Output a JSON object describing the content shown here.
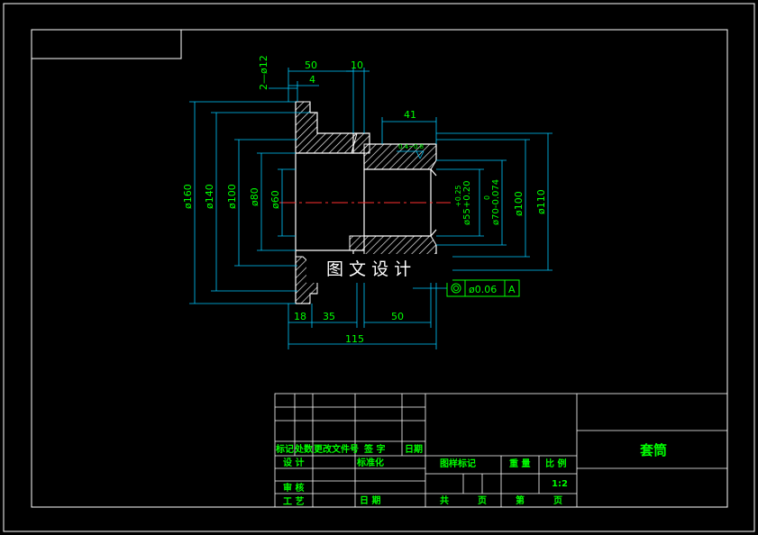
{
  "watermark": "图 文 设 计",
  "part_name": "套筒",
  "scale_value": "1:2",
  "dimensions": {
    "d_holes": "2—ø12",
    "len_50_top": "50",
    "len_10": "10",
    "len_4": "4",
    "len_41": "41",
    "dia_160": "ø160",
    "dia_140": "ø140",
    "dia_100_left": "ø100",
    "dia_80": "ø80",
    "dia_60": "ø60",
    "dia_55": "ø55+0.20",
    "dia_55_tol_upper": "+0.25",
    "dia_70": "ø70-0.074",
    "dia_70_tol_upper": "0",
    "dia_100_right": "ø100",
    "dia_110": "ø110",
    "chamfer": "0.4~0.8",
    "len_18": "18",
    "len_35": "35",
    "len_50_bottom": "50",
    "len_115": "115"
  },
  "tolerance_frame": {
    "value": "ø0.06",
    "datum": "A"
  },
  "title_block": {
    "rev_headers": [
      "标记",
      "处数",
      "更改文件号",
      "签 字",
      "日期"
    ],
    "design": "设 计",
    "standardize": "标准化",
    "review": "审 核",
    "process": "工 艺",
    "date": "日 期",
    "stage_mark": "图样标记",
    "weight": "重 量",
    "scale": "比 例",
    "total": "共",
    "sheet": "页",
    "number": "第",
    "sheet2": "页"
  }
}
